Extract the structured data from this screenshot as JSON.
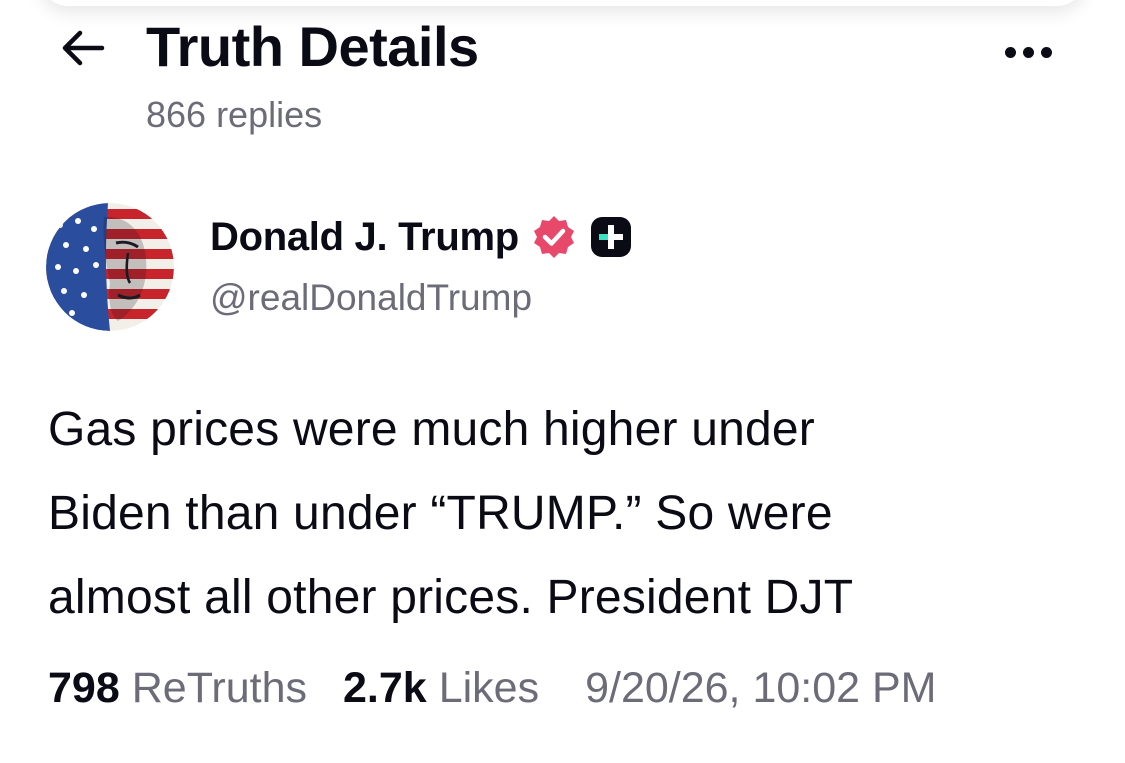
{
  "header": {
    "title": "Truth Details",
    "replies": "866 replies",
    "back_icon": "arrow-left-icon",
    "more_icon": "more-horizontal-icon"
  },
  "author": {
    "name": "Donald J. Trump",
    "handle": "@realDonaldTrump",
    "verified_icon": "verified-badge-icon",
    "verified_color": "#e8496b",
    "plus_icon": "truth-plus-icon",
    "plus_accent": "#3ce0c3"
  },
  "post": {
    "lines": [
      "Gas prices were much higher under",
      "Biden than under “TRUMP.” So were",
      "almost all other prices. President DJT"
    ]
  },
  "stats": {
    "retruths_count": "798",
    "retruths_label": "ReTruths",
    "likes_count": "2.7k",
    "likes_label": "Likes",
    "timestamp": "9/20/26, 10:02 PM"
  },
  "colors": {
    "text_primary": "#0b0b16",
    "text_secondary": "#6b6c78"
  }
}
